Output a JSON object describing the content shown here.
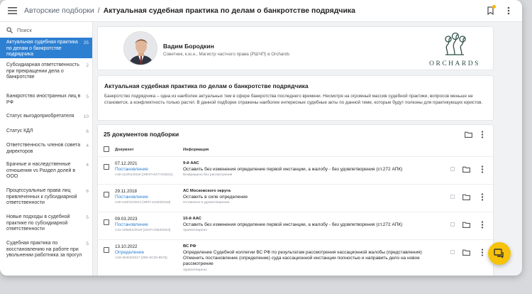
{
  "header": {
    "breadcrumb_parent": "Авторские подборки",
    "breadcrumb_separator": "/",
    "breadcrumb_current": "Актуальная судебная практика по делам о банкротстве подрядчика"
  },
  "sidebar": {
    "search_placeholder": "Поиск",
    "items": [
      {
        "label": "Актуальная судебная практика по делам о банкротстве подрядчика",
        "count": "25",
        "active": true
      },
      {
        "label": "Субсидиарная ответственность при прекращении дела о банкротстве",
        "count": "2"
      },
      {
        "label": "Банкротство иностранных лиц в РФ",
        "count": "5"
      },
      {
        "label": "Статус выгодоприобретателя",
        "count": "10"
      },
      {
        "label": "Статус КДЛ",
        "count": "6"
      },
      {
        "label": "Ответственность членов совета директоров",
        "count": "4"
      },
      {
        "label": "Брачные и наследственные отношения vs Раздел долей в ООО",
        "count": "4"
      },
      {
        "label": "Процессуальные права лиц привлеченных к субсидиарной ответственности",
        "count": "6"
      },
      {
        "label": "Новые подходы в судебной практике по субсидиарной ответственности",
        "count": "5"
      },
      {
        "label": "Судебная практика по восстановлению на работе при увольнении работника за прогул",
        "count": "5"
      }
    ]
  },
  "author": {
    "name": "Вадим Бородкин",
    "title": "Советник, к.ю.н., Магистр частного права (РШЧП) в Orchards",
    "logo_text": "ORCHARDS",
    "logo_color": "#2f4f47"
  },
  "collection": {
    "title": "Актуальная судебная практика по делам о банкротстве подрядчика",
    "description": "Банкротство подрядчика – одна из наиболее актуальных тем в сфере банкротства последнего времени. Несмотря на огромный массив судебной практики, вопросов меньше не становится, а конфликтность только растет. В данной подборке отражены наиболее интересные судебные акты по данной теме, которые будут полезны для практикующих юристов."
  },
  "documents": {
    "heading": "25 документов подборки",
    "col_document": "Документ",
    "col_info": "Информация",
    "rows": [
      {
        "date": "07.12.2021",
        "type": "Постановление",
        "number": "А40-112/01/2019 [ЭФАП-64774/2021]",
        "court": "9-й ААС",
        "text": "Оставить без изменения определение первой инстанции, а жалобу - без удовлетворения (ст.272 АПК)",
        "status": "Возвращено без рассмотрения"
      },
      {
        "date": "29.11.2018",
        "type": "Постановление",
        "number": "А40-140/21/2013 [ЭФП-12263/2018]",
        "court": "АС Московского округа",
        "text": "Оставить в силе определение",
        "status": "Оставлено в удовлетворения"
      },
      {
        "date": "09.03.2023",
        "type": "Постановление",
        "number": "А41-108301/2019 [10АП-2363/2023]",
        "court": "10-й ААС",
        "text": "Оставить без изменения определение первой инстанции, а жалобу - без удовлетворения (ст.272 АПК)",
        "status": "Удовлетворено"
      },
      {
        "date": "13.10.2022",
        "type": "Определение",
        "number": "А33-30403/2017 [308-ЭС20-8576]",
        "court": "ВС РФ",
        "text": "Определение Судебной коллегии ВС РФ по результатам рассмотрения кассационной жалобы (представления) Отменить постановление (определение) суда кассационной инстанции полностью и направить дело на новое рассмотрение",
        "status": "Удовлетворено"
      }
    ]
  },
  "colors": {
    "accent": "#2d7fd1",
    "fab": "#f6c20a",
    "notification_dot": "#f5b700"
  }
}
